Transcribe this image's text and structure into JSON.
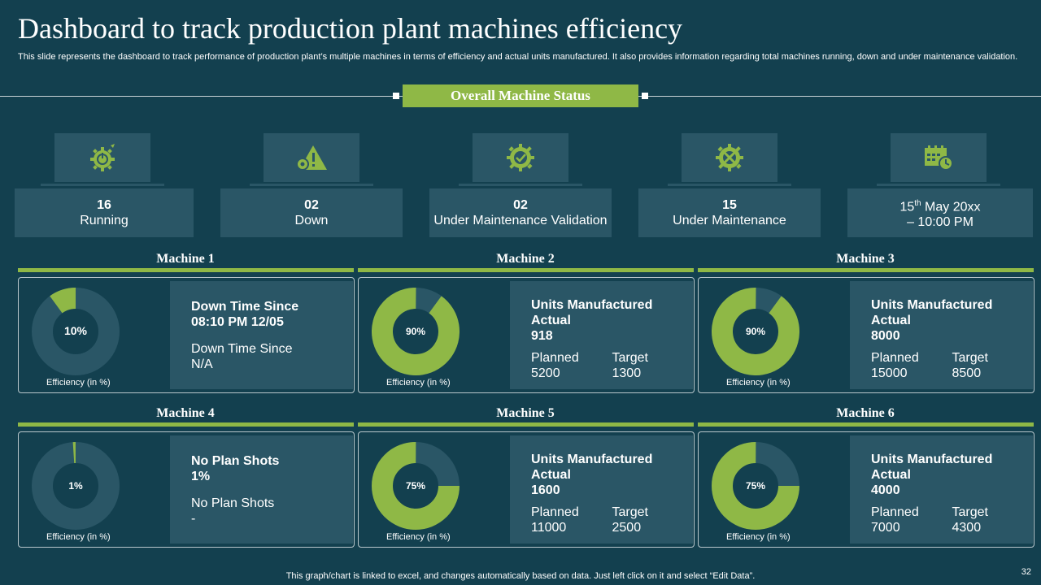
{
  "title": "Dashboard to track production plant machines efficiency",
  "subtitle": "This slide represents the dashboard to track performance of production plant’s multiple machines in terms of efficiency and actual units manufactured. It also provides information regarding total machines running, down and under maintenance validation.",
  "status_title": "Overall Machine Status",
  "colors": {
    "background": "#13404f",
    "panel": "#2a5666",
    "accent": "#8fb846",
    "ring_track": "#2a5666"
  },
  "status_items": [
    {
      "icon": "gear-power-icon",
      "value": "16",
      "label": "Running"
    },
    {
      "icon": "warning-gear-icon",
      "value": "02",
      "label": "Down"
    },
    {
      "icon": "gear-check-icon",
      "value": "02",
      "label": "Under Maintenance Validation"
    },
    {
      "icon": "wrench-gear-icon",
      "value": "15",
      "label": "Under Maintenance"
    },
    {
      "icon": "calendar-clock-icon",
      "date_day": "15",
      "date_sup": "th",
      "date_rest": " May 20xx",
      "time": "– 10:00 PM"
    }
  ],
  "efficiency_label": "Efficiency (in %)",
  "machines": [
    {
      "name": "Machine 1",
      "efficiency": 10,
      "efficiency_label": "10%",
      "line1": "Down Time Since",
      "line2": "08:10 PM 12/05",
      "line3": "Down Time Since",
      "line4": "N/A"
    },
    {
      "name": "Machine 2",
      "efficiency": 90,
      "efficiency_label": "90%",
      "heading": "Units Manufactured",
      "sub": "Actual",
      "actual": "918",
      "planned_label": "Planned",
      "planned": "5200",
      "target_label": "Target",
      "target": "1300"
    },
    {
      "name": "Machine 3",
      "efficiency": 90,
      "efficiency_label": "90%",
      "heading": "Units Manufactured",
      "sub": "Actual",
      "actual": "8000",
      "planned_label": "Planned",
      "planned": "15000",
      "target_label": "Target",
      "target": "8500"
    },
    {
      "name": "Machine 4",
      "efficiency": 1,
      "efficiency_label": "1%",
      "line1": "No Plan Shots",
      "line2": "1%",
      "line3": "No Plan Shots",
      "line4": "-"
    },
    {
      "name": "Machine 5",
      "efficiency": 75,
      "efficiency_label": "75%",
      "heading": "Units Manufactured",
      "sub": "Actual",
      "actual": "1600",
      "planned_label": "Planned",
      "planned": "11000",
      "target_label": "Target",
      "target": "2500"
    },
    {
      "name": "Machine 6",
      "efficiency": 75,
      "efficiency_label": "75%",
      "heading": "Units Manufactured",
      "sub": "Actual",
      "actual": "4000",
      "planned_label": "Planned",
      "planned": "7000",
      "target_label": "Target",
      "target": "4300"
    }
  ],
  "footer": "This graph/chart is linked to excel,  and changes automatically based on data. Just left click on it and select “Edit Data”.",
  "page_number": "32"
}
